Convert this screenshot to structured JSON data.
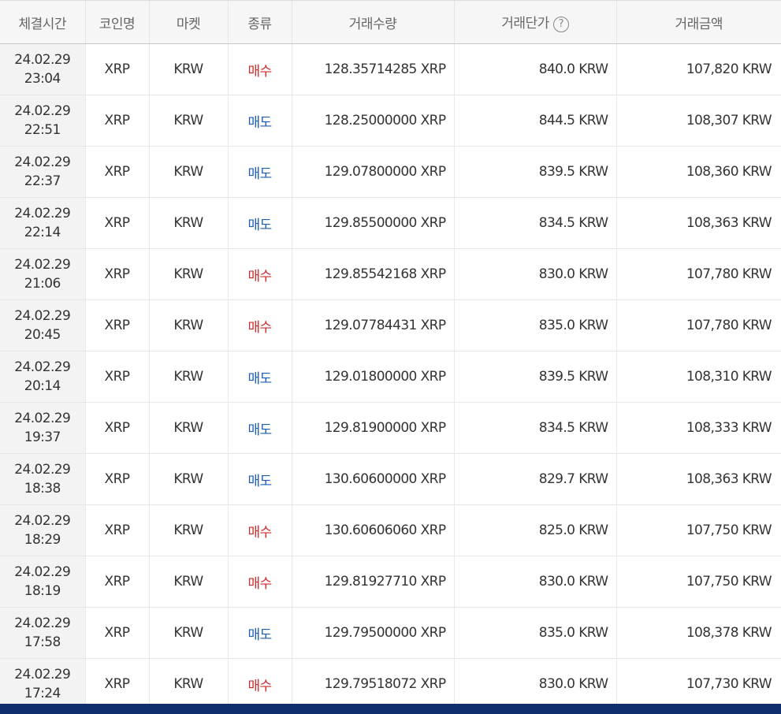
{
  "table": {
    "headers": {
      "time": "체결시간",
      "coin": "코인명",
      "market": "마켓",
      "type": "종류",
      "quantity": "거래수량",
      "price": "거래단가",
      "amount": "거래금액"
    },
    "help_icon_glyph": "?",
    "rows": [
      {
        "date": "24.02.29",
        "time": "23:04",
        "coin": "XRP",
        "market": "KRW",
        "type": "매수",
        "side": "buy",
        "quantity": "128.35714285 XRP",
        "price": "840.0 KRW",
        "amount": "107,820 KRW"
      },
      {
        "date": "24.02.29",
        "time": "22:51",
        "coin": "XRP",
        "market": "KRW",
        "type": "매도",
        "side": "sell",
        "quantity": "128.25000000 XRP",
        "price": "844.5 KRW",
        "amount": "108,307 KRW"
      },
      {
        "date": "24.02.29",
        "time": "22:37",
        "coin": "XRP",
        "market": "KRW",
        "type": "매도",
        "side": "sell",
        "quantity": "129.07800000 XRP",
        "price": "839.5 KRW",
        "amount": "108,360 KRW"
      },
      {
        "date": "24.02.29",
        "time": "22:14",
        "coin": "XRP",
        "market": "KRW",
        "type": "매도",
        "side": "sell",
        "quantity": "129.85500000 XRP",
        "price": "834.5 KRW",
        "amount": "108,363 KRW"
      },
      {
        "date": "24.02.29",
        "time": "21:06",
        "coin": "XRP",
        "market": "KRW",
        "type": "매수",
        "side": "buy",
        "quantity": "129.85542168 XRP",
        "price": "830.0 KRW",
        "amount": "107,780 KRW"
      },
      {
        "date": "24.02.29",
        "time": "20:45",
        "coin": "XRP",
        "market": "KRW",
        "type": "매수",
        "side": "buy",
        "quantity": "129.07784431 XRP",
        "price": "835.0 KRW",
        "amount": "107,780 KRW"
      },
      {
        "date": "24.02.29",
        "time": "20:14",
        "coin": "XRP",
        "market": "KRW",
        "type": "매도",
        "side": "sell",
        "quantity": "129.01800000 XRP",
        "price": "839.5 KRW",
        "amount": "108,310 KRW"
      },
      {
        "date": "24.02.29",
        "time": "19:37",
        "coin": "XRP",
        "market": "KRW",
        "type": "매도",
        "side": "sell",
        "quantity": "129.81900000 XRP",
        "price": "834.5 KRW",
        "amount": "108,333 KRW"
      },
      {
        "date": "24.02.29",
        "time": "18:38",
        "coin": "XRP",
        "market": "KRW",
        "type": "매도",
        "side": "sell",
        "quantity": "130.60600000 XRP",
        "price": "829.7 KRW",
        "amount": "108,363 KRW"
      },
      {
        "date": "24.02.29",
        "time": "18:29",
        "coin": "XRP",
        "market": "KRW",
        "type": "매수",
        "side": "buy",
        "quantity": "130.60606060 XRP",
        "price": "825.0 KRW",
        "amount": "107,750 KRW"
      },
      {
        "date": "24.02.29",
        "time": "18:19",
        "coin": "XRP",
        "market": "KRW",
        "type": "매수",
        "side": "buy",
        "quantity": "129.81927710 XRP",
        "price": "830.0 KRW",
        "amount": "107,750 KRW"
      },
      {
        "date": "24.02.29",
        "time": "17:58",
        "coin": "XRP",
        "market": "KRW",
        "type": "매도",
        "side": "sell",
        "quantity": "129.79500000 XRP",
        "price": "835.0 KRW",
        "amount": "108,378 KRW"
      },
      {
        "date": "24.02.29",
        "time": "17:24",
        "coin": "XRP",
        "market": "KRW",
        "type": "매수",
        "side": "buy",
        "quantity": "129.79518072 XRP",
        "price": "830.0 KRW",
        "amount": "107,730 KRW"
      }
    ]
  },
  "colors": {
    "buy": "#d12b2b",
    "sell": "#1c5cb8",
    "header_bg": "#f6f6f6",
    "time_col_bg": "#f3f3f3",
    "bottom_bar": "#0f2e6e"
  }
}
